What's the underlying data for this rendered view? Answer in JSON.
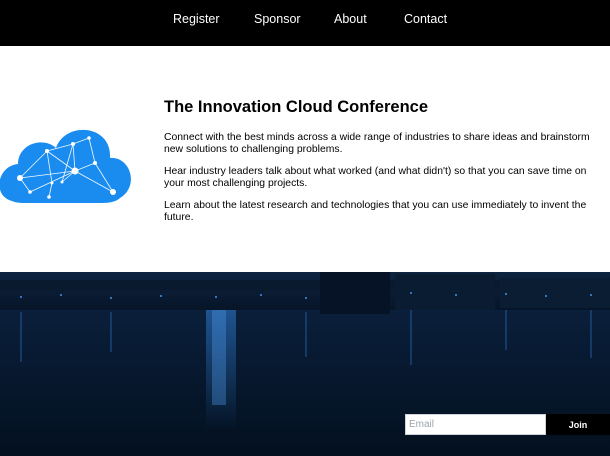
{
  "nav": {
    "items": [
      {
        "label": "Register"
      },
      {
        "label": "Sponsor"
      },
      {
        "label": "About"
      },
      {
        "label": "Contact"
      }
    ]
  },
  "intro": {
    "logo_icon": "cloud-network-icon",
    "title": "The Innovation Cloud Conference",
    "paragraphs": [
      "Connect with the best minds across a wide range of industries to share ideas and brainstorm new solutions to challenging problems.",
      "Hear industry leaders talk about what worked (and what didn't) so that you can save time on your most challenging projects.",
      "Learn about the latest research and technologies that you can use immediately to invent the future."
    ]
  },
  "signup": {
    "email_placeholder": "Email",
    "join_label": "Join"
  },
  "colors": {
    "nav_background": "#000000",
    "cloud_blue": "#1a8cf0",
    "hero_dark": "#071427",
    "join_button": "#000000"
  }
}
